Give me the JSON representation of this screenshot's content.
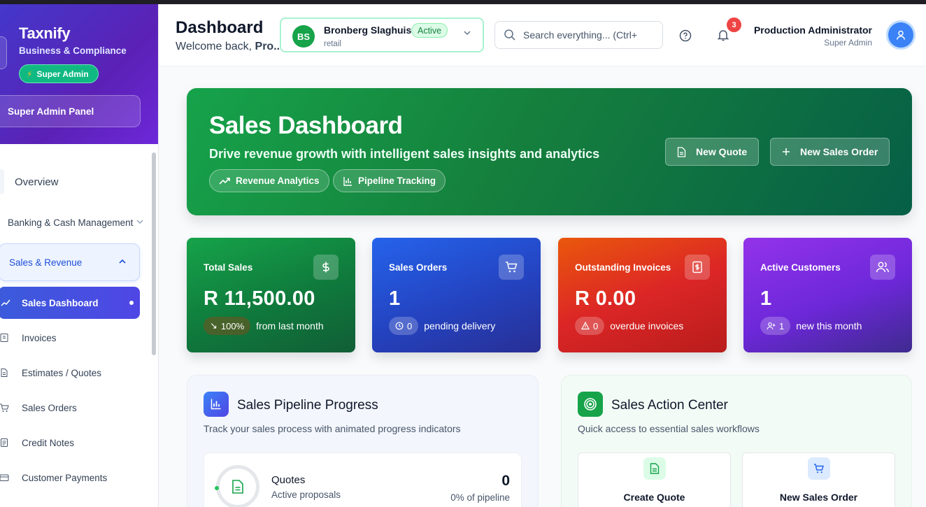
{
  "sidebar": {
    "brand": "Taxnify",
    "subtitle": "Business & Compliance",
    "badge": "Super Admin",
    "panel": "Super Admin Panel",
    "overview": "Overview",
    "banking": "Banking & Cash Management",
    "sales_group": "Sales & Revenue",
    "active_item": "Sales Dashboard",
    "sub_items": [
      {
        "label": "Invoices",
        "icon": "receipt-icon"
      },
      {
        "label": "Estimates / Quotes",
        "icon": "document-icon"
      },
      {
        "label": "Sales Orders",
        "icon": "cart-icon"
      },
      {
        "label": "Credit Notes",
        "icon": "note-icon"
      },
      {
        "label": "Customer Payments",
        "icon": "card-icon"
      }
    ]
  },
  "header": {
    "title": "Dashboard",
    "welcome": "Welcome back,",
    "welcome_name": "Pro...",
    "company": {
      "initials": "BS",
      "name": "Bronberg Slaghuis",
      "status": "Active",
      "type": "retail"
    },
    "search_placeholder": "Search everything... (Ctrl+",
    "notifications": "3",
    "user_name": "Production Administrator",
    "user_role": "Super Admin"
  },
  "hero": {
    "title": "Sales Dashboard",
    "subtitle": "Drive revenue growth with intelligent sales insights and analytics",
    "pill_1": "Revenue Analytics",
    "pill_2": "Pipeline Tracking",
    "btn_quote": "New Quote",
    "btn_order": "New Sales Order"
  },
  "cards": [
    {
      "label": "Total Sales",
      "value": "R 11,500.00",
      "chip": "100%",
      "note": "from last month"
    },
    {
      "label": "Sales Orders",
      "value": "1",
      "chip": "0",
      "note": "pending delivery"
    },
    {
      "label": "Outstanding Invoices",
      "value": "R 0.00",
      "chip": "0",
      "note": "overdue invoices"
    },
    {
      "label": "Active Customers",
      "value": "1",
      "chip": "1",
      "note": "new this month"
    }
  ],
  "pipeline": {
    "title": "Sales Pipeline Progress",
    "subtitle": "Track your sales process with animated progress indicators",
    "item": {
      "name": "Quotes",
      "desc": "Active proposals",
      "value": "0",
      "pct": "0% of pipeline"
    }
  },
  "actions": {
    "title": "Sales Action Center",
    "subtitle": "Quick access to essential sales workflows",
    "items": [
      "Create Quote",
      "New Sales Order"
    ]
  },
  "colors": {
    "brand": "#4f46e5",
    "success": "#16a34a",
    "danger": "#dc2626",
    "purple": "#7c3aed"
  }
}
